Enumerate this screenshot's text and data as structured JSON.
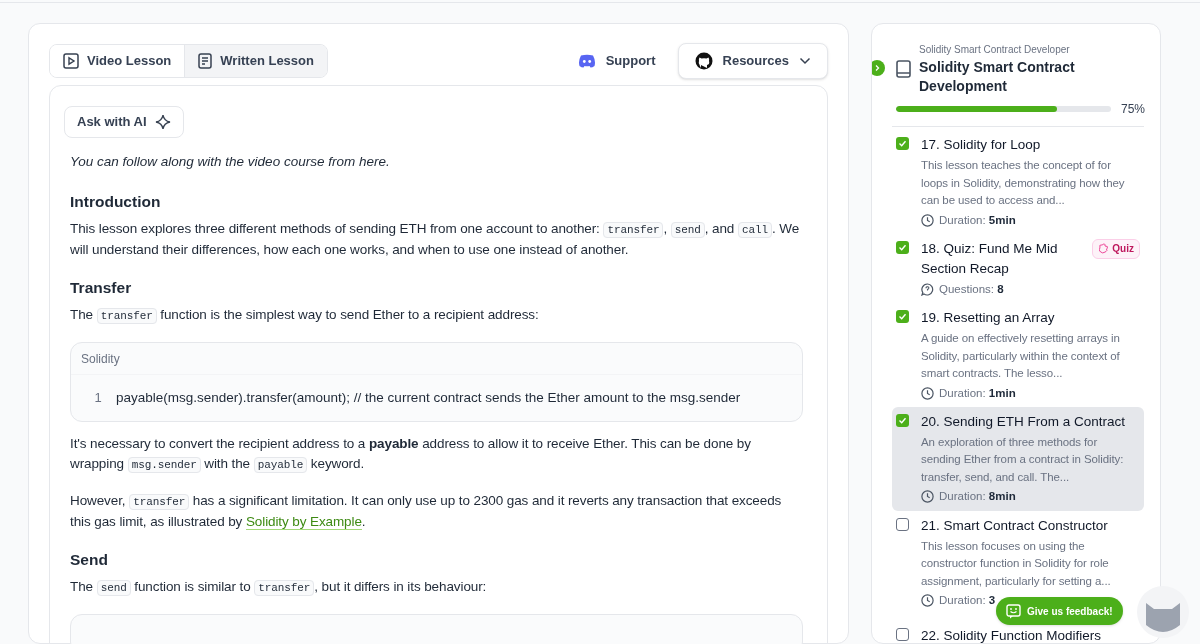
{
  "view_tabs": [
    {
      "label": "Video Lesson",
      "selected": false
    },
    {
      "label": "Written Lesson",
      "selected": true
    }
  ],
  "support_link": "Support",
  "resources_button": "Resources",
  "ask_ai_button": "Ask with AI",
  "content": [
    {
      "kind": "note",
      "segments": [
        {
          "kind": "text",
          "text": "You can follow along with the video course from here."
        }
      ]
    },
    {
      "kind": "heading",
      "text": "Introduction"
    },
    {
      "kind": "paragraph",
      "segments": [
        {
          "kind": "text",
          "text": "This lesson explores three different methods of sending ETH from one account to another: "
        },
        {
          "kind": "code",
          "text": "transfer"
        },
        {
          "kind": "text",
          "text": ", "
        },
        {
          "kind": "code",
          "text": "send"
        },
        {
          "kind": "text",
          "text": ", and "
        },
        {
          "kind": "code",
          "text": "call"
        },
        {
          "kind": "text",
          "text": ". We will understand their differences, how each one works, and when to use one instead of another."
        }
      ]
    },
    {
      "kind": "heading",
      "text": "Transfer"
    },
    {
      "kind": "paragraph",
      "segments": [
        {
          "kind": "text",
          "text": "The "
        },
        {
          "kind": "code",
          "text": "transfer"
        },
        {
          "kind": "text",
          "text": " function is the simplest way to send Ether to a recipient address:"
        }
      ]
    },
    {
      "kind": "codeblock",
      "language": "Solidity",
      "lines": [
        {
          "number": "1",
          "code": "payable(msg.sender).transfer(amount); // the current contract sends the Ether amount to the msg.sender"
        }
      ]
    },
    {
      "kind": "paragraph",
      "segments": [
        {
          "kind": "text",
          "text": "It's necessary to convert the recipient address to a "
        },
        {
          "kind": "bold",
          "text": "payable"
        },
        {
          "kind": "text",
          "text": " address to allow it to receive Ether. This can be done by wrapping "
        },
        {
          "kind": "code",
          "text": "msg.sender"
        },
        {
          "kind": "text",
          "text": " with the "
        },
        {
          "kind": "code",
          "text": "payable"
        },
        {
          "kind": "text",
          "text": " keyword."
        }
      ]
    },
    {
      "kind": "paragraph",
      "segments": [
        {
          "kind": "text",
          "text": "However, "
        },
        {
          "kind": "code",
          "text": "transfer"
        },
        {
          "kind": "text",
          "text": " has a significant limitation. It can only use up to 2300 gas and it reverts any transaction that exceeds this gas limit, as illustrated by "
        },
        {
          "kind": "link",
          "text": "Solidity by Example"
        },
        {
          "kind": "text",
          "text": "."
        }
      ]
    },
    {
      "kind": "heading",
      "text": "Send"
    },
    {
      "kind": "paragraph",
      "segments": [
        {
          "kind": "text",
          "text": "The "
        },
        {
          "kind": "code",
          "text": "send"
        },
        {
          "kind": "text",
          "text": " function is similar to "
        },
        {
          "kind": "code",
          "text": "transfer"
        },
        {
          "kind": "text",
          "text": ", but it differs in its behaviour:"
        }
      ]
    },
    {
      "kind": "codeblock_cut"
    }
  ],
  "course": {
    "subtitle": "Solidity Smart Contract Developer",
    "title": "Solidity Smart Contract Development",
    "level": 0.75,
    "percent": "75%"
  },
  "lessons": [
    {
      "kind": "lesson",
      "title": "17. Solidity for Loop",
      "description": "This lesson teaches the concept of for loops in Solidity, demonstrating how they can be used to access and...",
      "meta_label": "Duration:",
      "meta_value": "5min",
      "checked": true,
      "selected": false
    },
    {
      "kind": "quiz",
      "title": "18. Quiz: Fund Me Mid Section Recap",
      "badge": "Quiz",
      "meta_label": "Questions:",
      "meta_value": "8",
      "checked": true,
      "selected": false
    },
    {
      "kind": "lesson",
      "title": "19. Resetting an Array",
      "description": "A guide on effectively resetting arrays in Solidity, particularly within the context of smart contracts. The lesso...",
      "meta_label": "Duration:",
      "meta_value": "1min",
      "checked": true,
      "selected": false
    },
    {
      "kind": "lesson",
      "title": "20. Sending ETH From a Contract",
      "description": "An exploration of three methods for sending Ether from a contract in Solidity: transfer, send, and call. The...",
      "meta_label": "Duration:",
      "meta_value": "8min",
      "checked": true,
      "selected": true
    },
    {
      "kind": "lesson",
      "title": "21. Smart Contract Constructor",
      "description": "This lesson focuses on using the constructor function in Solidity for role assignment, particularly for setting a...",
      "meta_label": "Duration:",
      "meta_value": "3",
      "checked": false,
      "selected": false
    },
    {
      "kind": "title_only",
      "title": "22. Solidity Function Modifiers",
      "checked": false,
      "selected": false
    }
  ],
  "feedback_button": "Give us feedback!"
}
